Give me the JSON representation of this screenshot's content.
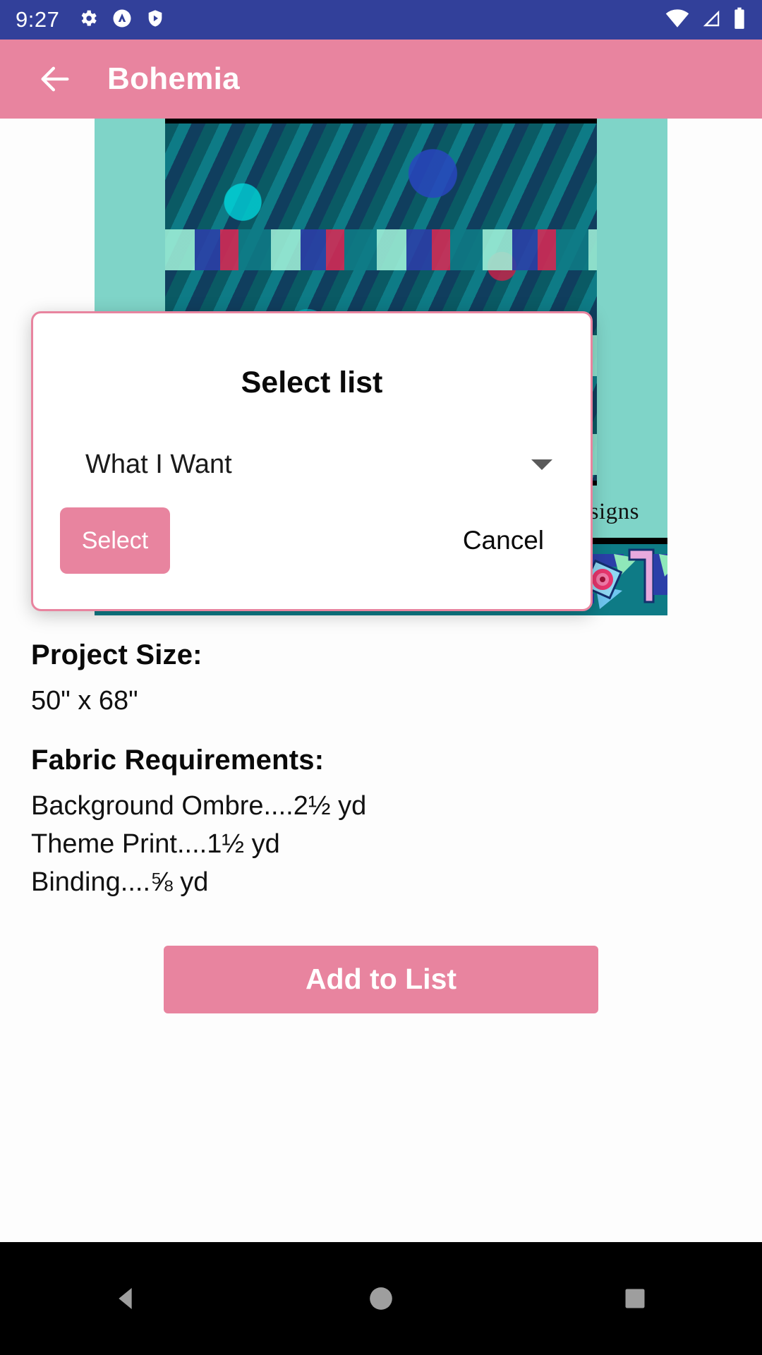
{
  "status_bar": {
    "time": "9:27",
    "background_color": "#32409a",
    "left_icons": [
      "gear-icon",
      "circle-caret-icon",
      "shield-play-icon"
    ],
    "right_icons": [
      "wifi-icon",
      "cell-signal-icon",
      "battery-icon"
    ]
  },
  "app_bar": {
    "title": "Bohemia",
    "back_icon": "arrow-back-icon",
    "background_color": "#e8849f",
    "text_color": "#ffffff"
  },
  "pattern_image": {
    "maker_text": "Villa Rosa Designs",
    "teal_color": "#7fd4c8",
    "border_color": "#0e7b86"
  },
  "dialog": {
    "title": "Select list",
    "dropdown": {
      "value": "What I Want",
      "caret_icon": "chevron-down-icon"
    },
    "select_label": "Select",
    "cancel_label": "Cancel",
    "accent_color": "#e8849f",
    "border_color": "#e8849f"
  },
  "details": {
    "project_size_heading": "Project Size:",
    "project_size_value": "50\" x 68\"",
    "fabric_heading": "Fabric Requirements:",
    "fabric_lines": [
      "Background Ombre....2½ yd",
      "Theme Print....1½ yd",
      "Binding....⅝ yd"
    ]
  },
  "actions": {
    "add_to_list_label": "Add to List"
  },
  "nav_bar": {
    "background_color": "#000000",
    "buttons": [
      "back-triangle-icon",
      "home-circle-icon",
      "recents-square-icon"
    ]
  }
}
